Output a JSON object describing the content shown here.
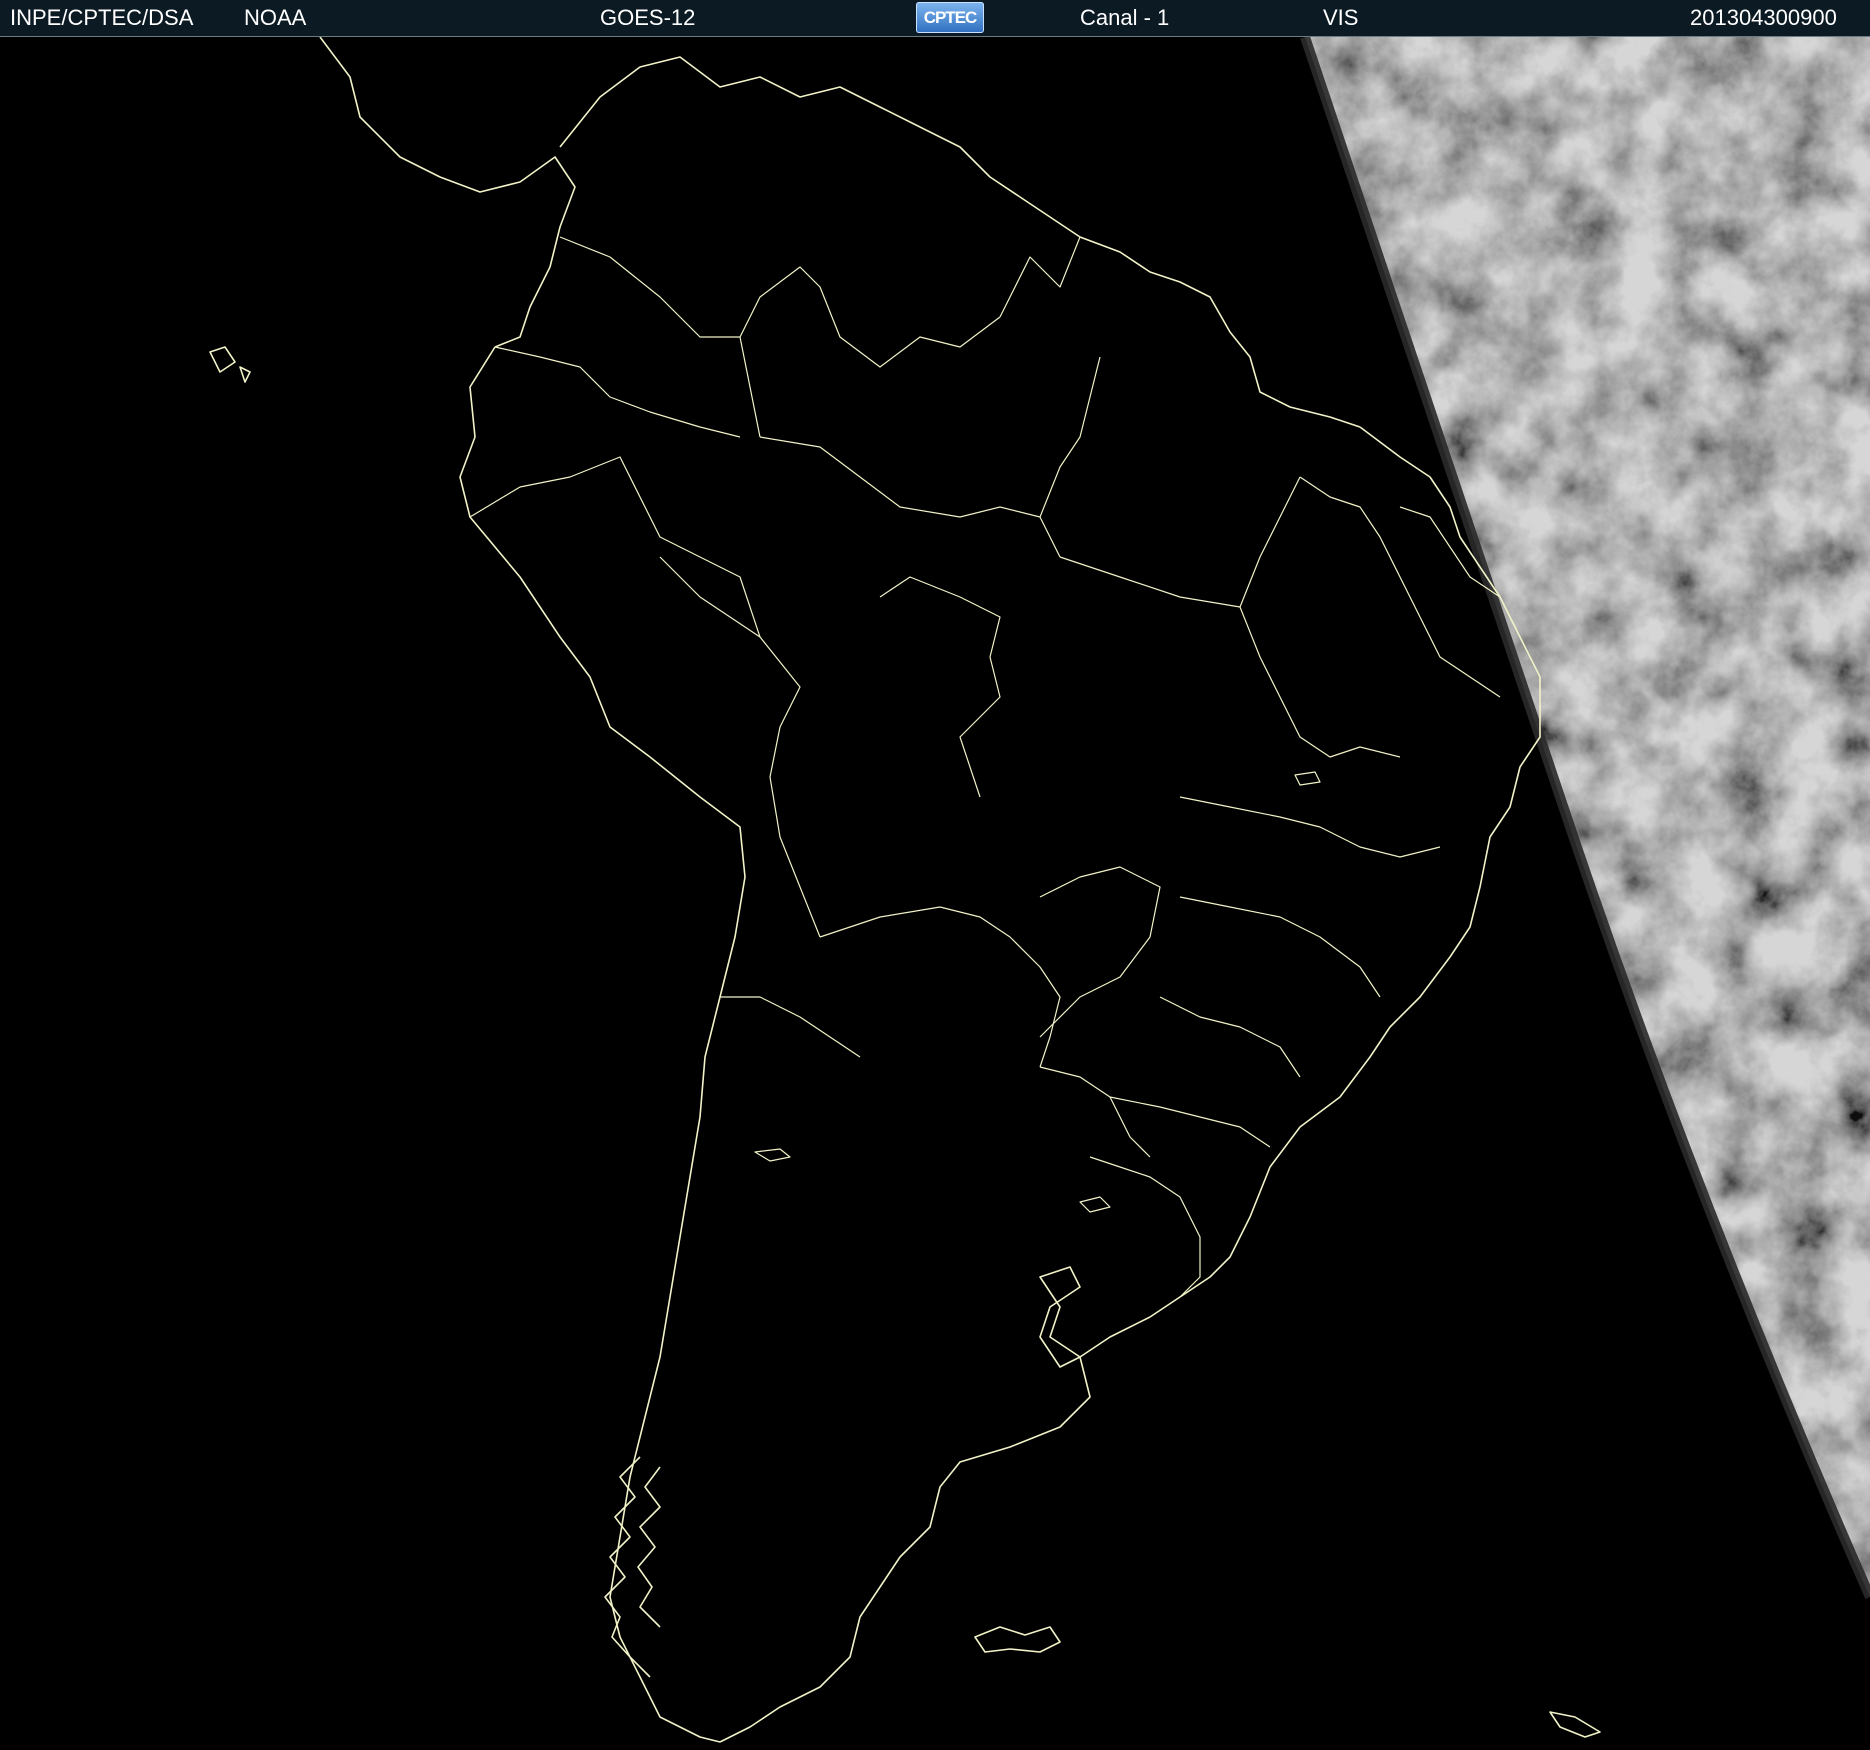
{
  "header": {
    "agency": "INPE/CPTEC/DSA",
    "provider": "NOAA",
    "satellite": "GOES-12",
    "logo_text": "CPTEC",
    "channel": "Canal - 1",
    "band": "VIS",
    "timestamp": "201304300900"
  },
  "colors": {
    "header_bg": "#0c1a24",
    "coastline": "#f2f2c8",
    "cloud": "#c8c8c8",
    "space": "#000000"
  },
  "icons": {
    "logo": "cptec-logo"
  }
}
